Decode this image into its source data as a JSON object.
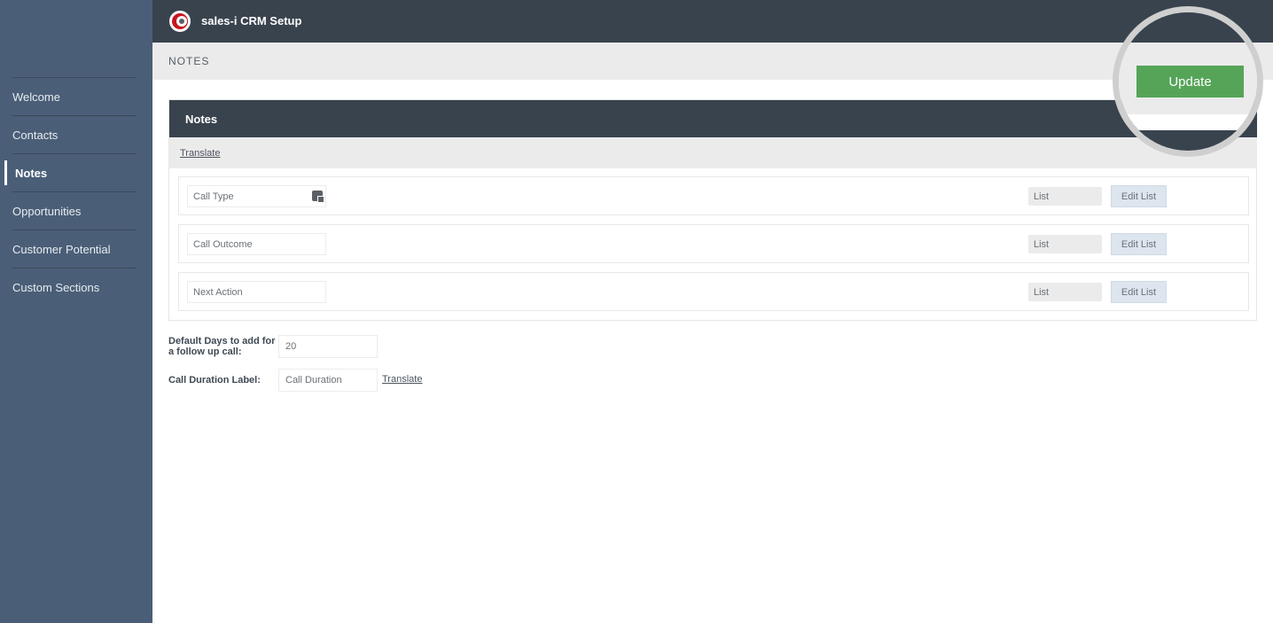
{
  "app": {
    "title": "sales-i CRM Setup",
    "logo": "sales-i-logo"
  },
  "sidebar": {
    "items": [
      {
        "label": "Welcome",
        "active": false
      },
      {
        "label": "Contacts",
        "active": false
      },
      {
        "label": "Notes",
        "active": true
      },
      {
        "label": "Opportunities",
        "active": false
      },
      {
        "label": "Customer Potential",
        "active": false
      },
      {
        "label": "Custom Sections",
        "active": false
      }
    ]
  },
  "page": {
    "section_title": "NOTES",
    "update_label": "Update"
  },
  "panel": {
    "title": "Notes",
    "translate_label": "Translate",
    "rows": [
      {
        "field_value": "Call Type",
        "has_icon": true,
        "icon": "translate-keyboard-icon",
        "type_value": "List",
        "edit_label": "Edit List"
      },
      {
        "field_value": "Call Outcome",
        "has_icon": false,
        "type_value": "List",
        "edit_label": "Edit List"
      },
      {
        "field_value": "Next Action",
        "has_icon": false,
        "type_value": "List",
        "edit_label": "Edit List"
      }
    ]
  },
  "settings": {
    "default_days_label": "Default Days to add for a follow up call:",
    "default_days_value": "20",
    "call_duration_label": "Call Duration Label:",
    "call_duration_value": "Call Duration",
    "translate_label": "Translate"
  },
  "colors": {
    "sidebar": "#4a5e77",
    "header": "#39434e",
    "accent_green": "#55a458",
    "highlight_ring": "#cfcfcf"
  }
}
